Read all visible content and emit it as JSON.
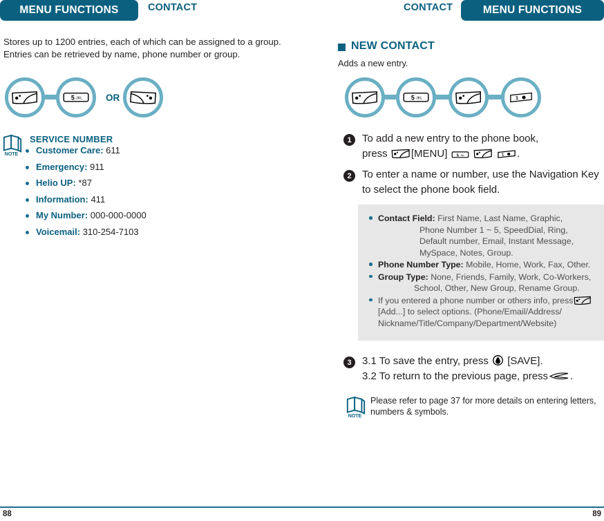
{
  "left_page": {
    "header_bar": "MENU FUNCTIONS",
    "header_side": "CONTACT",
    "intro": "Stores up to 1200 entries, each of which can be assigned to a group. Entries can be retrieved by name, phone number or group.",
    "key_sequence": {
      "or_label": "OR",
      "keys": [
        "left-soft-key",
        "5 JKL",
        "right-soft-key"
      ]
    },
    "note": {
      "icon_label": "NOTE",
      "title": "SERVICE NUMBER",
      "items": [
        {
          "label": "Customer Care:",
          "value": "611"
        },
        {
          "label": "Emergency:",
          "value": "911"
        },
        {
          "label": "Helio UP:",
          "value": "*87"
        },
        {
          "label": "Information:",
          "value": "411"
        },
        {
          "label": "My Number:",
          "value": "000-000-0000"
        },
        {
          "label": "Voicemail:",
          "value": "310-254-7103"
        }
      ]
    },
    "page_number": "88"
  },
  "right_page": {
    "header_bar": "MENU FUNCTIONS",
    "header_side": "CONTACT",
    "section_title": "NEW CONTACT",
    "section_sub": "Adds a new entry.",
    "key_sequence": {
      "keys": [
        "left-soft-key",
        "5 JKL",
        "left-soft-key",
        "1 key"
      ]
    },
    "steps": [
      {
        "num": "1",
        "line1": "To add a new entry to the phone book,",
        "line2_prefix": "press",
        "line2_menu": "[MENU]",
        "line2_suffix": "."
      },
      {
        "num": "2",
        "line1": "To enter a name or number, use the Navigation Key",
        "line2": "to select the phone book field."
      },
      {
        "num": "3",
        "line1_a": "3.1 To save the entry, press",
        "line1_b": "[SAVE].",
        "line2_a": "3.2 To return to the previous page, press",
        "line2_b": "."
      }
    ],
    "gray_box": {
      "items": [
        {
          "label": "Contact Field:",
          "value": "First Name, Last Name, Graphic,",
          "cont": [
            "Phone Number 1 ~ 5, SpeedDial, Ring,",
            "Default number, Email, Instant Message,",
            "MySpace, Notes, Group."
          ]
        },
        {
          "label": "Phone Number Type:",
          "value": "Mobile, Home, Work, Fax, Other.",
          "cont": []
        },
        {
          "label": "Group Type:",
          "value": "None, Friends, Family, Work, Co-Workers,",
          "cont": [
            "School, Other, New Group, Rename Group."
          ]
        },
        {
          "label": "",
          "value": "If you entered a phone number or others info, press",
          "cont": [
            "[Add...] to select options. (Phone/Email/Address/",
            "Nickname/Title/Company/Department/Website)"
          ]
        }
      ]
    },
    "bottom_note": {
      "icon_label": "NOTE",
      "text": "Please refer to page 37 for more details on entering letters, numbers & symbols."
    },
    "page_number": "89"
  },
  "colors": {
    "header_bar": "#0b6080",
    "accent": "#0b6080",
    "ring": "#6aafc4",
    "gray_box": "#e7e7e7",
    "text": "#231f20"
  }
}
